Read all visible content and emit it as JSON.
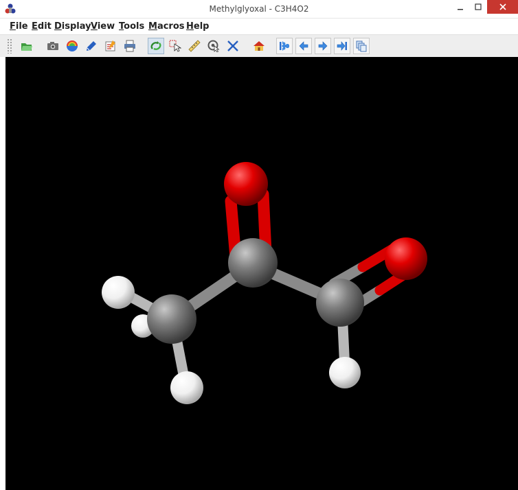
{
  "window": {
    "title": "Methylglyoxal - C3H4O2"
  },
  "menus": [
    "File",
    "Edit",
    "Display",
    "View",
    "Tools",
    "Macros",
    "Help"
  ],
  "menu_accelerators": [
    "F",
    "E",
    "D",
    "V",
    "T",
    "M",
    "H"
  ],
  "toolbar": {
    "buttons": [
      {
        "name": "open-file",
        "icon": "folder-open-icon"
      },
      {
        "name": "export-image",
        "icon": "camera-icon"
      },
      {
        "name": "povray",
        "icon": "rainbow-globe-icon"
      },
      {
        "name": "script-console",
        "icon": "pen-icon"
      },
      {
        "name": "edit-script",
        "icon": "editor-icon"
      },
      {
        "name": "print",
        "icon": "printer-icon"
      },
      {
        "name": "rotate",
        "icon": "rotate-icon",
        "state": "pressed"
      },
      {
        "name": "pick",
        "icon": "select-cursor-icon"
      },
      {
        "name": "measure",
        "icon": "ruler-icon"
      },
      {
        "name": "pick-center",
        "icon": "center-icon"
      },
      {
        "name": "translate",
        "icon": "crosshair-icon"
      },
      {
        "name": "home",
        "icon": "home-icon"
      },
      {
        "name": "first-frame",
        "icon": "first-frame-icon"
      },
      {
        "name": "previous-frame",
        "icon": "previous-frame-icon"
      },
      {
        "name": "next-frame",
        "icon": "next-frame-icon"
      },
      {
        "name": "last-frame",
        "icon": "last-frame-icon"
      },
      {
        "name": "copy-frames",
        "icon": "copy-icon"
      }
    ]
  },
  "molecule": {
    "atoms": [
      {
        "element": "O",
        "role": "ketone-oxygen"
      },
      {
        "element": "C",
        "role": "carbonyl-carbon"
      },
      {
        "element": "C",
        "role": "methyl-carbon"
      },
      {
        "element": "C",
        "role": "aldehyde-carbon"
      },
      {
        "element": "O",
        "role": "aldehyde-oxygen"
      },
      {
        "element": "H",
        "role": "methyl-hydrogen"
      },
      {
        "element": "H",
        "role": "methyl-hydrogen"
      },
      {
        "element": "H",
        "role": "methyl-hydrogen"
      },
      {
        "element": "H",
        "role": "aldehyde-hydrogen"
      }
    ],
    "colors": {
      "background": "#000000",
      "carbon": "#7a7a7a",
      "oxygen": "#e00000",
      "hydrogen": "#f2f2f2"
    }
  }
}
